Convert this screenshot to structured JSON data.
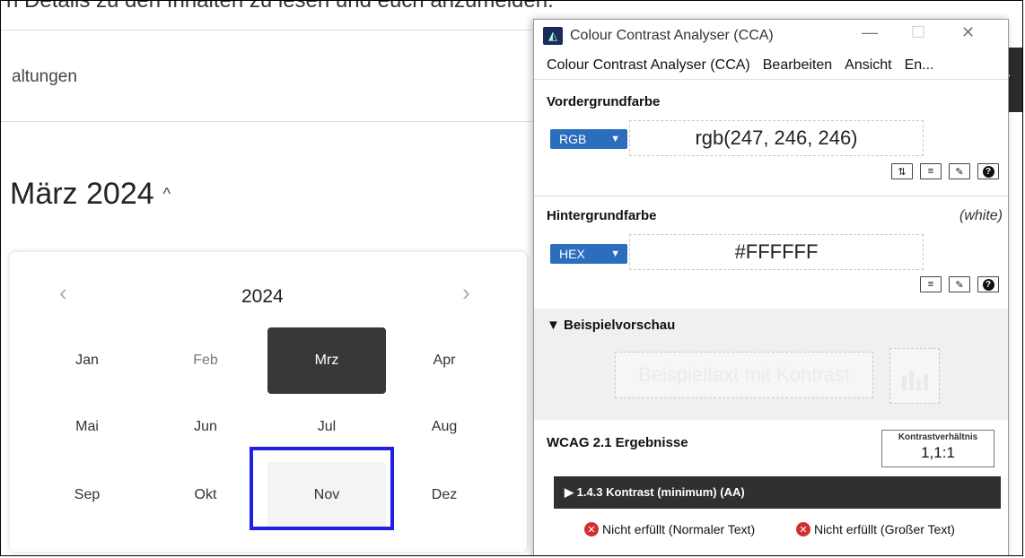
{
  "page": {
    "top_text": "n Details zu den Inhalten zu lesen und euch anzumelden.",
    "nav_text": "altungen",
    "month_title": "März 2024",
    "caret": "^",
    "dark_button_text": "r"
  },
  "calendar": {
    "year": "2024",
    "prev": "‹",
    "next": "›",
    "months": [
      "Jan",
      "Feb",
      "Mrz",
      "Apr",
      "Mai",
      "Jun",
      "Jul",
      "Aug",
      "Sep",
      "Okt",
      "Nov",
      "Dez"
    ],
    "selected": "Mrz",
    "hovered": "Nov"
  },
  "cca": {
    "title": "Colour Contrast Analyser (CCA)",
    "window_controls": {
      "minimize": "—",
      "maximize": "☐",
      "close": "✕"
    },
    "menu": [
      "Colour Contrast Analyser (CCA)",
      "Bearbeiten",
      "Ansicht",
      "En..."
    ],
    "foreground": {
      "label": "Vordergrundfarbe",
      "format": "RGB",
      "value": "rgb(247, 246, 246)",
      "tools": [
        "⇅",
        "≡",
        "✎",
        "?"
      ]
    },
    "background": {
      "label": "Hintergrundfarbe",
      "name": "(white)",
      "format": "HEX",
      "value": "#FFFFFF",
      "tools": [
        "≡",
        "✎",
        "?"
      ]
    },
    "preview": {
      "label": "▼ Beispielvorschau",
      "sample_text": "Beispieltext mit Kontrast"
    },
    "results": {
      "label": "WCAG 2.1 Ergebnisse",
      "ratio_label": "Kontrastverhältnis",
      "ratio_value": "1,1:1",
      "criterion": "▶  1.4.3 Kontrast (minimum) (AA)",
      "normal_text": "Nicht erfüllt (Normaler Text)",
      "large_text": "Nicht erfüllt (Großer Text)"
    },
    "colors": {
      "accent": "#2a6ebd",
      "fail": "#d32f2f",
      "bar": "#303030"
    }
  }
}
